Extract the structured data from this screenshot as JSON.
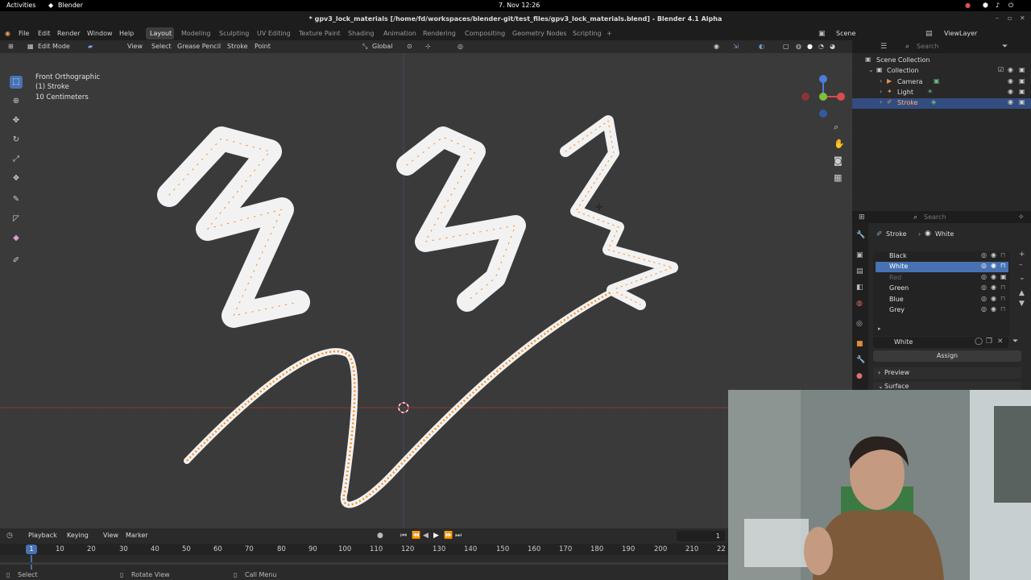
{
  "gnome": {
    "activities": "Activities",
    "app": "Blender",
    "clock": "7. Nov 12:26"
  },
  "window_title": "* gpv3_lock_materials [/home/fd/workspaces/blender-git/test_files/gpv3_lock_materials.blend] - Blender 4.1 Alpha",
  "menu": [
    "File",
    "Edit",
    "Render",
    "Window",
    "Help"
  ],
  "workspaces": [
    "Layout",
    "Modeling",
    "Sculpting",
    "UV Editing",
    "Texture Paint",
    "Shading",
    "Animation",
    "Rendering",
    "Compositing",
    "Geometry Nodes",
    "Scripting"
  ],
  "scene": "Scene",
  "view_layer": "ViewLayer",
  "viewport_header": {
    "mode": "Edit Mode",
    "view": "View",
    "select": "Select",
    "grease_pencil": "Grease Pencil",
    "stroke": "Stroke",
    "point": "Point",
    "transform": "Global"
  },
  "overlay": {
    "view_name": "Front Orthographic",
    "object": "(1) Stroke",
    "scale": "10 Centimeters"
  },
  "outliner": {
    "search_placeholder": "Search",
    "root": "Scene Collection",
    "collection": "Collection",
    "items": [
      "Camera",
      "Light",
      "Stroke"
    ]
  },
  "properties": {
    "search_placeholder": "Search",
    "breadcrumb_object": "Stroke",
    "breadcrumb_material": "White",
    "materials": [
      "Black",
      "White",
      "Red",
      "Green",
      "Blue",
      "Grey"
    ],
    "selected_material": "White",
    "material_name": "White",
    "assign": "Assign",
    "preview": "Preview",
    "surface": "Surface"
  },
  "timeline": {
    "playback": "Playback",
    "keying": "Keying",
    "view": "View",
    "marker": "Marker",
    "current_frame": "1",
    "current_frame_field": "1",
    "ticks": [
      "10",
      "20",
      "30",
      "40",
      "50",
      "60",
      "70",
      "80",
      "90",
      "100",
      "110",
      "120",
      "130",
      "140",
      "150",
      "160",
      "170",
      "180",
      "190",
      "200",
      "210",
      "22"
    ]
  },
  "status": {
    "select": "Select",
    "rotate": "Rotate View",
    "call_menu": "Call Menu"
  },
  "colors": {
    "accent": "#4772b3",
    "selected_point": "#ff8c1a",
    "stroke_fill": "#f2f2f2"
  }
}
